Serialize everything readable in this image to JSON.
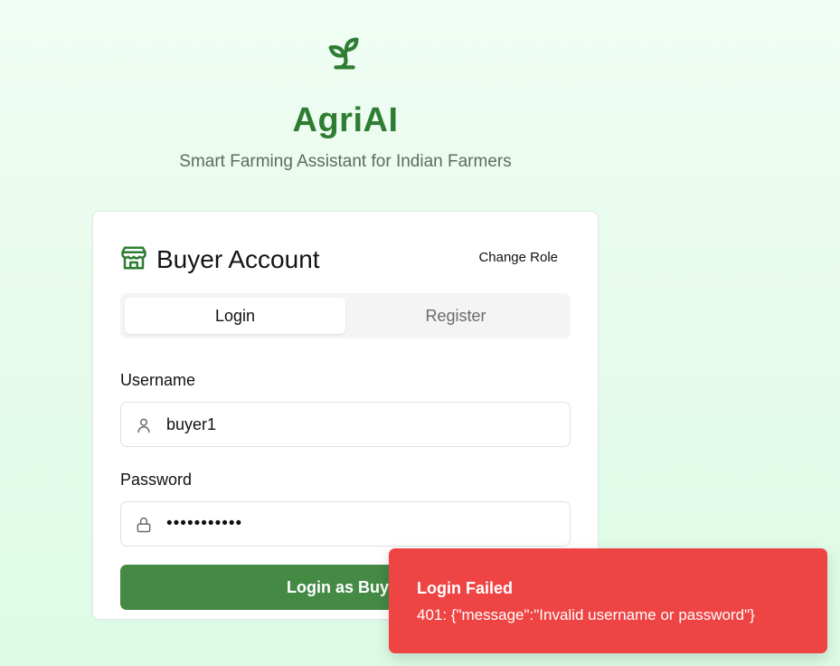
{
  "brand": {
    "title": "AgriAI",
    "subtitle": "Smart Farming Assistant for Indian Farmers",
    "icon": "sprout-icon",
    "color": "#2e7d32"
  },
  "card": {
    "icon": "store-icon",
    "title": "Buyer Account",
    "change_role_label": "Change Role"
  },
  "tabs": [
    {
      "label": "Login",
      "active": true
    },
    {
      "label": "Register",
      "active": false
    }
  ],
  "form": {
    "username_label": "Username",
    "username_value": "buyer1",
    "password_label": "Password",
    "password_value": "•••••••••••",
    "submit_label": "Login as Buyer",
    "submit_color": "#448a45"
  },
  "toast": {
    "title": "Login Failed",
    "message": "401: {\"message\":\"Invalid username or password\"}",
    "color": "#ef4444"
  }
}
